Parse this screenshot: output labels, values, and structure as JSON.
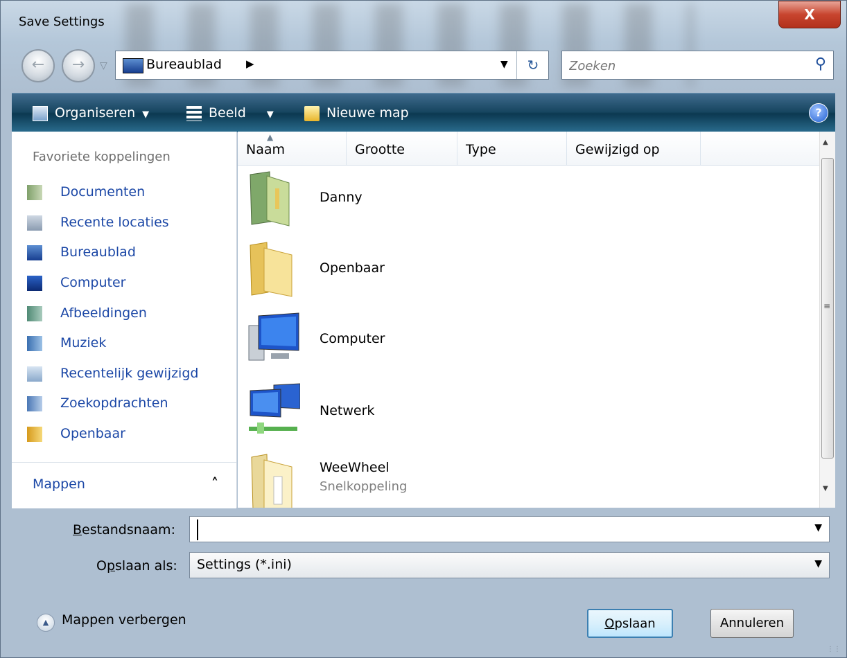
{
  "window": {
    "title": "Save Settings",
    "close_label": "X"
  },
  "nav": {
    "back_icon": "back-arrow-icon",
    "forward_icon": "forward-arrow-icon"
  },
  "address": {
    "path": "Bureaublad",
    "refresh_icon": "refresh-icon"
  },
  "search": {
    "placeholder": "Zoeken"
  },
  "toolbar": {
    "organize": "Organiseren",
    "view": "Beeld",
    "new_folder": "Nieuwe map",
    "help": "?"
  },
  "sidebar": {
    "favorites_title": "Favoriete koppelingen",
    "items": [
      {
        "label": "Documenten",
        "icon": "documents-icon"
      },
      {
        "label": "Recente locaties",
        "icon": "recent-places-icon"
      },
      {
        "label": "Bureaublad",
        "icon": "desktop-icon"
      },
      {
        "label": "Computer",
        "icon": "computer-icon"
      },
      {
        "label": "Afbeeldingen",
        "icon": "pictures-icon"
      },
      {
        "label": "Muziek",
        "icon": "music-icon"
      },
      {
        "label": "Recentelijk gewijzigd",
        "icon": "recently-changed-icon"
      },
      {
        "label": "Zoekopdrachten",
        "icon": "searches-icon"
      },
      {
        "label": "Openbaar",
        "icon": "public-folder-icon"
      }
    ],
    "folders_label": "Mappen"
  },
  "columns": {
    "name": "Naam",
    "size": "Grootte",
    "type": "Type",
    "modified": "Gewijzigd op"
  },
  "files": [
    {
      "name": "Danny",
      "icon": "user-folder-icon"
    },
    {
      "name": "Openbaar",
      "icon": "folder-icon"
    },
    {
      "name": "Computer",
      "icon": "computer-icon"
    },
    {
      "name": "Netwerk",
      "icon": "network-icon"
    },
    {
      "name": "WeeWheel",
      "sub": "Snelkoppeling",
      "icon": "shortcut-folder-icon"
    }
  ],
  "form": {
    "filename_label_prefix": "",
    "filename_label_u": "B",
    "filename_label_rest": "estandsnaam:",
    "filename_value": "",
    "type_label_pre": "O",
    "type_label_u": "p",
    "type_label_rest": "slaan als:",
    "type_value": "Settings (*.ini)"
  },
  "footer": {
    "hide_folders": "Mappen verbergen",
    "save_u": "O",
    "save_rest": "pslaan",
    "cancel": "Annuleren"
  }
}
